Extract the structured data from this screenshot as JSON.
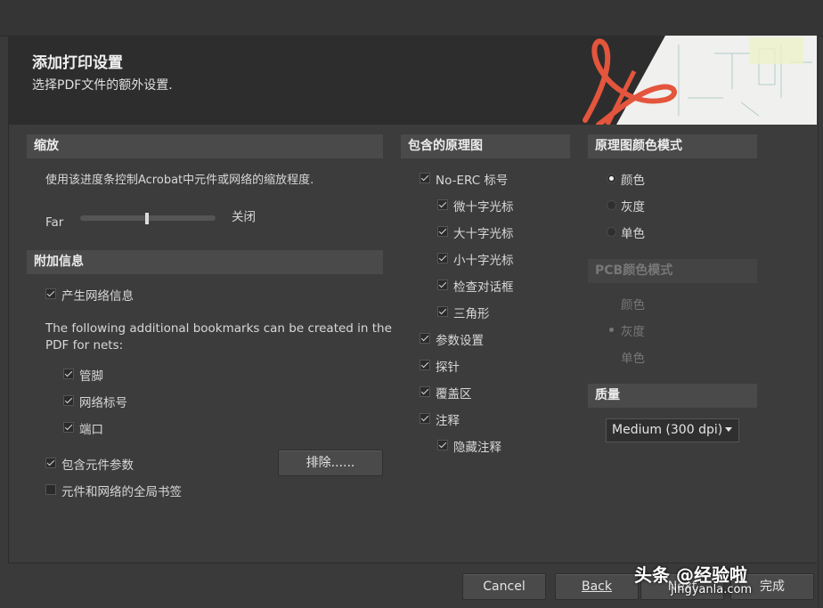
{
  "header": {
    "title": "添加打印设置",
    "subtitle": "选择PDF文件的额外设置."
  },
  "zoom": {
    "heading": "缩放",
    "description": "使用该进度条控制Acrobat中元件或网络的缩放程度.",
    "far_label": "Far",
    "close_label": "关闭",
    "slider_level": 0.5
  },
  "additional": {
    "heading": "附加信息",
    "generate_net_info": "产生网络信息",
    "bookmarks_text_line1": "The following additional bookmarks can be created in the",
    "bookmarks_text_line2": "PDF for nets:",
    "pins": "管脚",
    "net_labels": "网络标号",
    "ports": "端口",
    "include_params": "包含元件参数",
    "exclude_button": "排除......",
    "global_bookmarks": "元件和网络的全局书签"
  },
  "schematics": {
    "heading": "包含的原理图",
    "items": [
      {
        "label": "No-ERC 标号",
        "checked": true
      },
      {
        "label": "微十字光标",
        "checked": true
      },
      {
        "label": "大十字光标",
        "checked": true
      },
      {
        "label": "小十字光标",
        "checked": true
      },
      {
        "label": "检查对话框",
        "checked": true
      },
      {
        "label": "三角形",
        "checked": true
      },
      {
        "label": "参数设置",
        "checked": true
      },
      {
        "label": "探针",
        "checked": true
      },
      {
        "label": "覆盖区",
        "checked": true
      },
      {
        "label": "注释",
        "checked": true
      },
      {
        "label": "隐藏注释",
        "checked": true
      }
    ]
  },
  "sch_color": {
    "heading": "原理图颜色模式",
    "options": [
      "颜色",
      "灰度",
      "单色"
    ],
    "selected": "颜色"
  },
  "pcb_color": {
    "heading": "PCB颜色模式",
    "options": [
      "颜色",
      "灰度",
      "单色"
    ],
    "selected": "灰度"
  },
  "quality": {
    "heading": "质量",
    "value": "Medium (300 dpi)"
  },
  "footer": {
    "cancel": "Cancel",
    "back": "Back",
    "next": "Next",
    "finish": "完成"
  },
  "watermark": {
    "text1": "头条 @经验啦",
    "text2": "jingyanla.com"
  }
}
